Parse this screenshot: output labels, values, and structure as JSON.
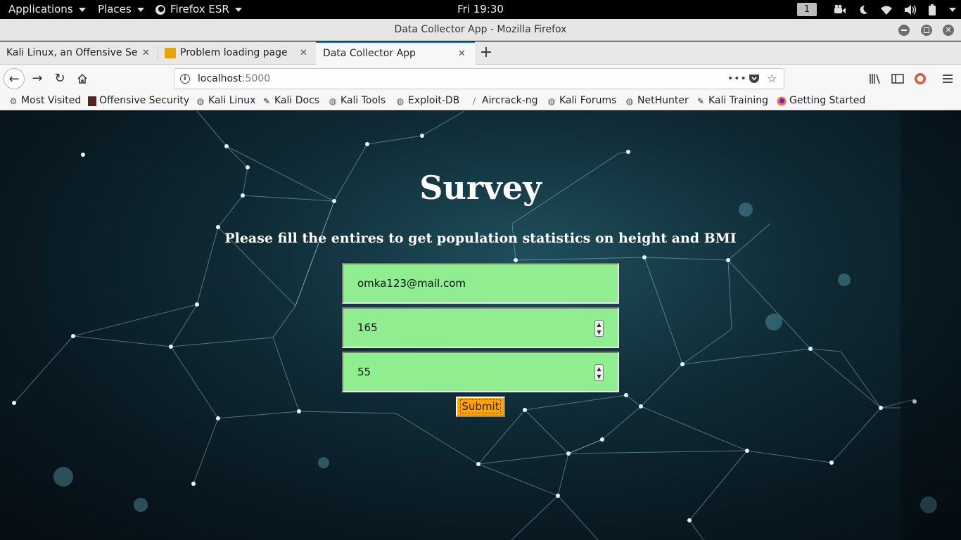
{
  "topbar": {
    "applications": "Applications",
    "places": "Places",
    "firefox": "Firefox ESR",
    "clock": "Fri 19:30",
    "workspace": "1"
  },
  "window": {
    "title": "Data Collector App - Mozilla Firefox"
  },
  "tabs": [
    {
      "label": "Kali Linux, an Offensive Security",
      "icon": "kali-favicon"
    },
    {
      "label": "Problem loading page",
      "icon": "warning-favicon"
    },
    {
      "label": "Data Collector App",
      "active": true
    }
  ],
  "navbar": {
    "url_host": "localhost",
    "url_port": ":5000"
  },
  "bookmarks": [
    {
      "label": "Most Visited",
      "icon": "gear-icon"
    },
    {
      "label": "Offensive Security",
      "icon": "offsec-icon"
    },
    {
      "label": "Kali Linux",
      "icon": "globe-icon"
    },
    {
      "label": "Kali Docs",
      "icon": "kali-dragon-icon"
    },
    {
      "label": "Kali Tools",
      "icon": "globe-icon"
    },
    {
      "label": "Exploit-DB",
      "icon": "globe-icon"
    },
    {
      "label": "Aircrack-ng",
      "icon": "aircrack-icon"
    },
    {
      "label": "Kali Forums",
      "icon": "globe-icon"
    },
    {
      "label": "NetHunter",
      "icon": "globe-icon"
    },
    {
      "label": "Kali Training",
      "icon": "kali-dragon-icon"
    },
    {
      "label": "Getting Started",
      "icon": "firefox-icon"
    }
  ],
  "page": {
    "title": "Survey",
    "subtitle": "Please fill the entires to get population statistics on height and BMI",
    "email_value": "omka123@mail.com",
    "height_value": "165",
    "weight_value": "55",
    "submit_label": "Submit"
  },
  "colors": {
    "field_bg": "#90ee90",
    "submit_bg": "#ffa500",
    "tab_accent": "#0a84ff"
  }
}
